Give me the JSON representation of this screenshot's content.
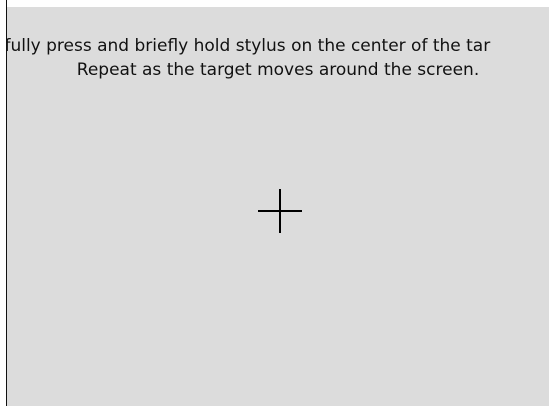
{
  "calibration": {
    "instruction_line_1": "efully press and briefly hold stylus on the center of the tar",
    "instruction_line_2": "Repeat as the target moves around the screen.",
    "target_icon": "crosshair-icon"
  },
  "colors": {
    "background": "#dcdcdc",
    "text": "#111111",
    "target": "#000000"
  }
}
